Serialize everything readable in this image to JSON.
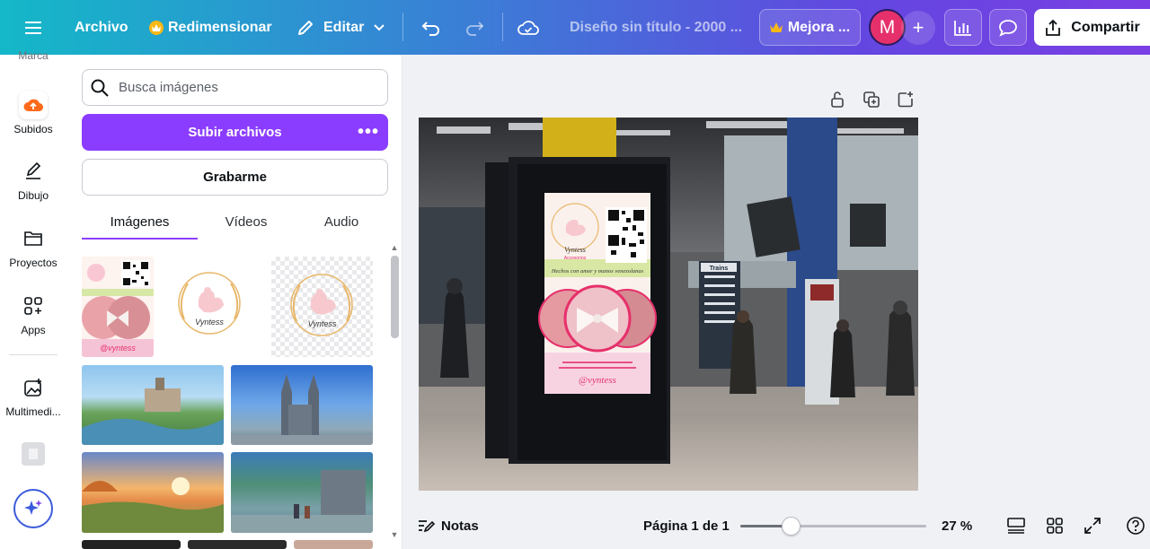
{
  "topbar": {
    "file_label": "Archivo",
    "resize_label": "Redimensionar",
    "edit_label": "Editar",
    "doc_title": "Diseño sin título - 2000 ...",
    "premium_label": "Mejora ...",
    "avatar_initial": "M",
    "share_label": "Compartir"
  },
  "rail": {
    "cut_label": "Marca",
    "items": [
      {
        "label": "Subidos",
        "icon": "cloud-upload-icon"
      },
      {
        "label": "Dibujo",
        "icon": "pen-icon"
      },
      {
        "label": "Proyectos",
        "icon": "folder-icon"
      },
      {
        "label": "Apps",
        "icon": "apps-grid-icon"
      },
      {
        "label": "Multimedi...",
        "icon": "media-icon"
      }
    ]
  },
  "panel": {
    "search_placeholder": "Busca imágenes",
    "upload_label": "Subir archivos",
    "record_label": "Grabarme",
    "tabs": [
      {
        "label": "Imágenes",
        "active": true
      },
      {
        "label": "Vídeos",
        "active": false
      },
      {
        "label": "Audio",
        "active": false
      }
    ],
    "thumbnails": [
      {
        "name": "flyer-vyntess",
        "caption": "@vyntess"
      },
      {
        "name": "logo-vyntess-white",
        "caption": "Vyntess"
      },
      {
        "name": "logo-vyntess-transparent",
        "caption": "Vyntess"
      },
      {
        "name": "landscape-river-town",
        "caption": ""
      },
      {
        "name": "landscape-cathedral",
        "caption": ""
      },
      {
        "name": "landscape-sunset-field",
        "caption": ""
      },
      {
        "name": "landscape-town-street",
        "caption": ""
      }
    ]
  },
  "design": {
    "poster_brand": "Vyntess",
    "poster_sub": "Accesorios",
    "poster_tagline": "Hechos con amor y manos venezolanas",
    "poster_handle": "@vyntess",
    "station_sign": "Trains"
  },
  "footer": {
    "notes_label": "Notas",
    "page_indicator": "Página 1 de 1",
    "zoom_label": "27 %",
    "zoom_fraction": 0.27
  }
}
